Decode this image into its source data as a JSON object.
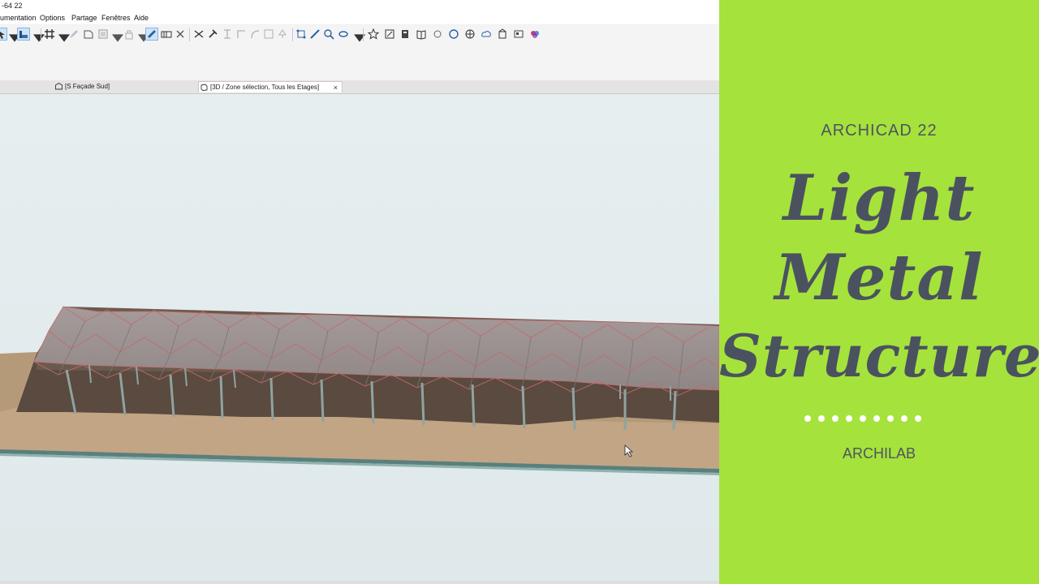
{
  "window": {
    "title": "-64 22"
  },
  "menu": [
    "umentation",
    "Options",
    "Partage",
    "Fenêtres",
    "Aide"
  ],
  "tabs": [
    {
      "label": "[S Façade Sud]",
      "active": false
    },
    {
      "label": "[3D / Zone sélection, Tous les Etages]",
      "active": true,
      "close": "×"
    }
  ],
  "toolbar": {
    "icons": [
      "arrow-icon",
      "magic-wand-icon",
      "grid-icon",
      "pencil-icon",
      "layers-icon",
      "lock-icon",
      "pick-up-icon",
      "ruler-icon",
      "dimension-icon",
      "cross-icon",
      "scissors-icon",
      "hammer-icon",
      "trim-icon",
      "corner-icon",
      "rotate-icon",
      "stretch-icon",
      "tree-icon",
      "select-object-icon",
      "brush-icon",
      "zoom-icon",
      "orbit-icon",
      "star-icon",
      "section-icon",
      "library-icon",
      "book-icon",
      "favorite-icon",
      "render-icon",
      "globe-icon",
      "cloud-icon",
      "building-icon",
      "palette-icon",
      "color-wheel-icon"
    ]
  },
  "panel": {
    "subtitle": "ARCHICAD 22",
    "title_lines": [
      "Light",
      "Metal",
      "Structure"
    ],
    "dots_count": 9,
    "author": "ARCHILAB",
    "background": "#a6e23c",
    "text_color": "#4a5260"
  }
}
